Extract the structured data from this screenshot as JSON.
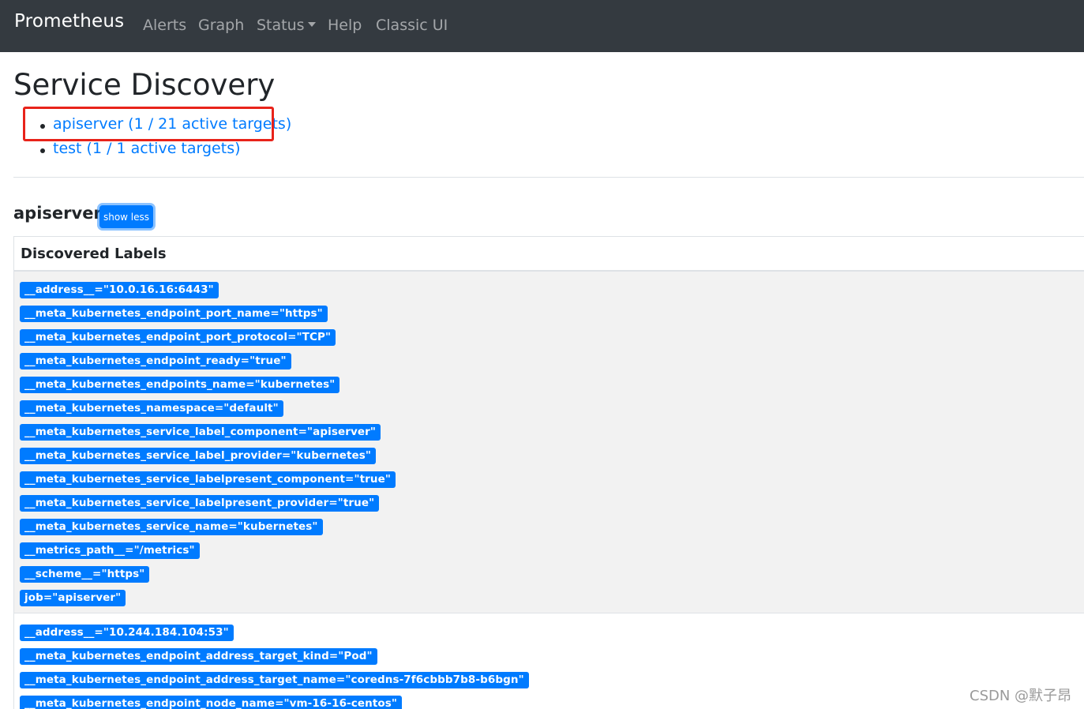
{
  "navbar": {
    "brand": "Prometheus",
    "items": [
      {
        "label": "Alerts"
      },
      {
        "label": "Graph"
      },
      {
        "label": "Status"
      },
      {
        "label": "Help"
      },
      {
        "label": "Classic UI"
      }
    ]
  },
  "page": {
    "title": "Service Discovery",
    "pools": [
      {
        "label": "apiserver (1 / 21 active targets)"
      },
      {
        "label": "test (1 / 1 active targets)"
      }
    ],
    "highlight_color": "#e8231a"
  },
  "section": {
    "title": "apiserver",
    "toggle_label": "show less",
    "table_header": "Discovered Labels",
    "row1_labels": [
      "__address__=\"10.0.16.16:6443\"",
      "__meta_kubernetes_endpoint_port_name=\"https\"",
      "__meta_kubernetes_endpoint_port_protocol=\"TCP\"",
      "__meta_kubernetes_endpoint_ready=\"true\"",
      "__meta_kubernetes_endpoints_name=\"kubernetes\"",
      "__meta_kubernetes_namespace=\"default\"",
      "__meta_kubernetes_service_label_component=\"apiserver\"",
      "__meta_kubernetes_service_label_provider=\"kubernetes\"",
      "__meta_kubernetes_service_labelpresent_component=\"true\"",
      "__meta_kubernetes_service_labelpresent_provider=\"true\"",
      "__meta_kubernetes_service_name=\"kubernetes\"",
      "__metrics_path__=\"/metrics\"",
      "__scheme__=\"https\"",
      "job=\"apiserver\""
    ],
    "row2_labels": [
      "__address__=\"10.244.184.104:53\"",
      "__meta_kubernetes_endpoint_address_target_kind=\"Pod\"",
      "__meta_kubernetes_endpoint_address_target_name=\"coredns-7f6cbbb7b8-b6bgn\"",
      "__meta_kubernetes_endpoint_node_name=\"vm-16-16-centos\""
    ]
  },
  "watermark": "CSDN @默子昂",
  "colors": {
    "navbar_bg": "#343a40",
    "link": "#007bff",
    "badge": "#007bff",
    "row_stripe": "#f2f2f2"
  }
}
